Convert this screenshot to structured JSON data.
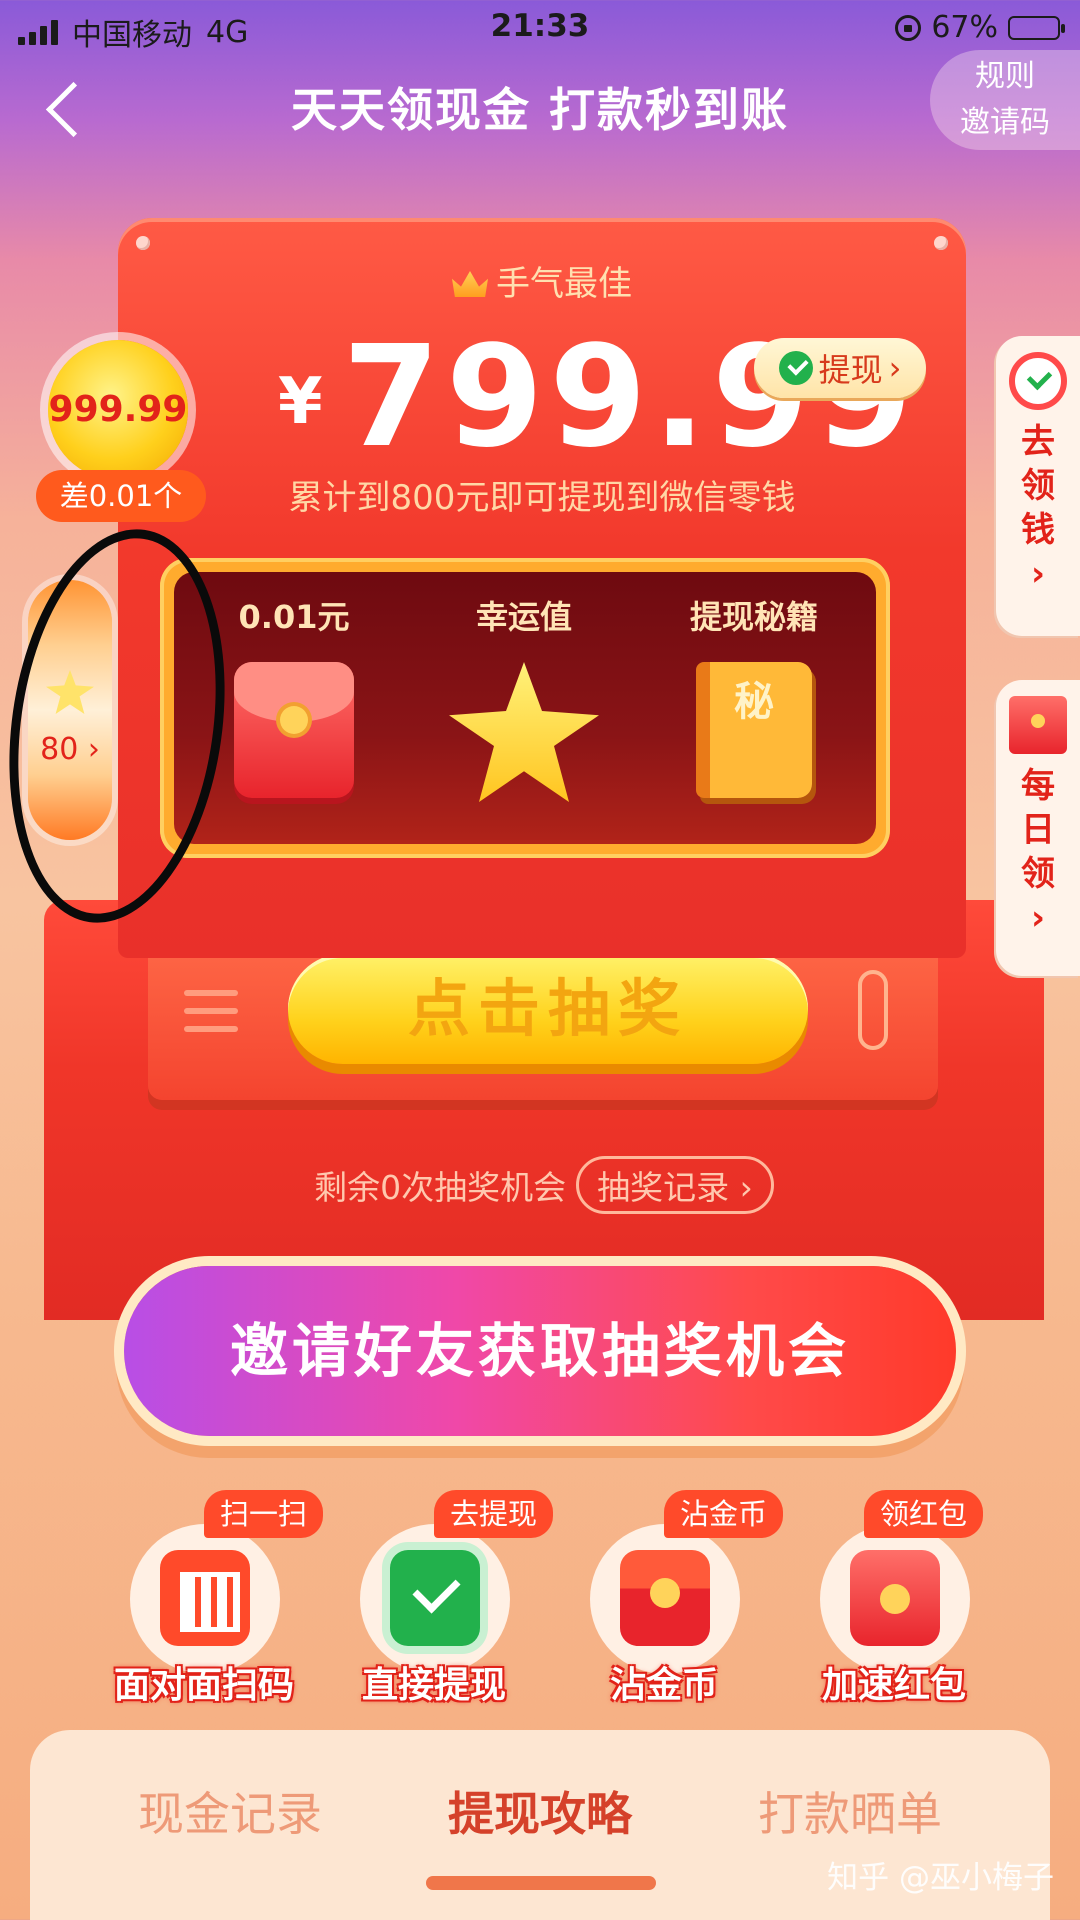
{
  "status_bar": {
    "carrier": "中国移动",
    "network": "4G",
    "time": "21:33",
    "battery": "67%",
    "battery_level": 0.67
  },
  "header": {
    "title": "天天领现金 打款秒到账",
    "rules": "规则",
    "invite_code": "邀请码"
  },
  "machine": {
    "best_luck": "手气最佳",
    "currency": "¥",
    "amount": "799.99",
    "withdraw_label": "提现",
    "withdraw_hint": "累计到800元即可提现到微信零钱",
    "screen": [
      {
        "label": "0.01元",
        "icon": "red-packet-icon"
      },
      {
        "label": "幸运值",
        "icon": "star-icon"
      },
      {
        "label": "提现秘籍",
        "icon": "secret-book-icon",
        "book_text": "秘"
      }
    ],
    "draw_button": "点击抽奖",
    "chances_text": "剩余0次抽奖机会",
    "record_button": "抽奖记录"
  },
  "left_float": {
    "coin_value": "999.99",
    "diff_text": "差0.01个",
    "luck_value": "80",
    "luck_arrow": "›"
  },
  "right_tabs": [
    {
      "label": "去领钱",
      "arrow": "›",
      "icon": "wallet-icon"
    },
    {
      "label": "每日领",
      "arrow": "›",
      "icon": "red-packet-icon"
    }
  ],
  "invite_button": "邀请好友获取抽奖机会",
  "actions": [
    {
      "tag": "扫一扫",
      "label": "面对面扫码",
      "icon": "qr-code-icon"
    },
    {
      "tag": "去提现",
      "label": "直接提现",
      "icon": "wechat-icon"
    },
    {
      "tag": "沾金币",
      "label": "沾金币",
      "icon": "treasure-chest-icon"
    },
    {
      "tag": "领红包",
      "label": "加速红包",
      "icon": "red-packet-icon"
    }
  ],
  "bottom_tabs": [
    {
      "label": "现金记录",
      "active": false
    },
    {
      "label": "提现攻略",
      "active": true
    },
    {
      "label": "打款晒单",
      "active": false
    }
  ],
  "watermark": "知乎 @巫小梅子",
  "colors": {
    "primary_red": "#e2231a",
    "gold": "#ffd21c",
    "wechat_green": "#22b14c"
  }
}
